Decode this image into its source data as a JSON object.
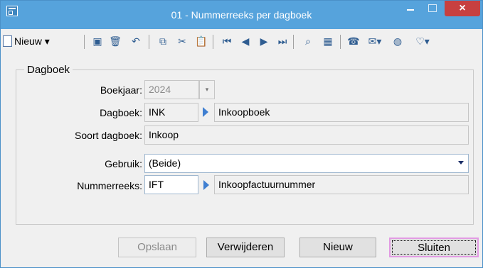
{
  "window": {
    "title": "01 - Nummerreeks per dagboek",
    "close_glyph": "×"
  },
  "toolbar": {
    "new_label": "Nieuw",
    "new_caret": "▾",
    "icons": [
      "save-icon",
      "delete-icon",
      "undo-icon",
      "copy-icon",
      "cut-icon",
      "paste-icon",
      "first-record-icon",
      "previous-record-icon",
      "next-record-icon",
      "last-record-icon",
      "search-binoculars-icon",
      "grid-icon",
      "phone-icon",
      "mail-icon",
      "globe-icon",
      "favorite-heart-icon"
    ]
  },
  "group": {
    "label": "Dagboek"
  },
  "form": {
    "boekjaar": {
      "label": "Boekjaar:",
      "value": "2024"
    },
    "dagboek": {
      "label": "Dagboek:",
      "code": "INK",
      "name": "Inkoopboek"
    },
    "soort": {
      "label": "Soort dagboek:",
      "value": "Inkoop"
    },
    "gebruik": {
      "label": "Gebruik:",
      "value": "(Beide)"
    },
    "nummerreeks": {
      "label": "Nummerreeks:",
      "code": "IFT",
      "name": "Inkoopfactuurnummer"
    }
  },
  "buttons": {
    "opslaan": "Opslaan",
    "verwijderen": "Verwijderen",
    "nieuw": "Nieuw",
    "sluiten": "Sluiten"
  }
}
